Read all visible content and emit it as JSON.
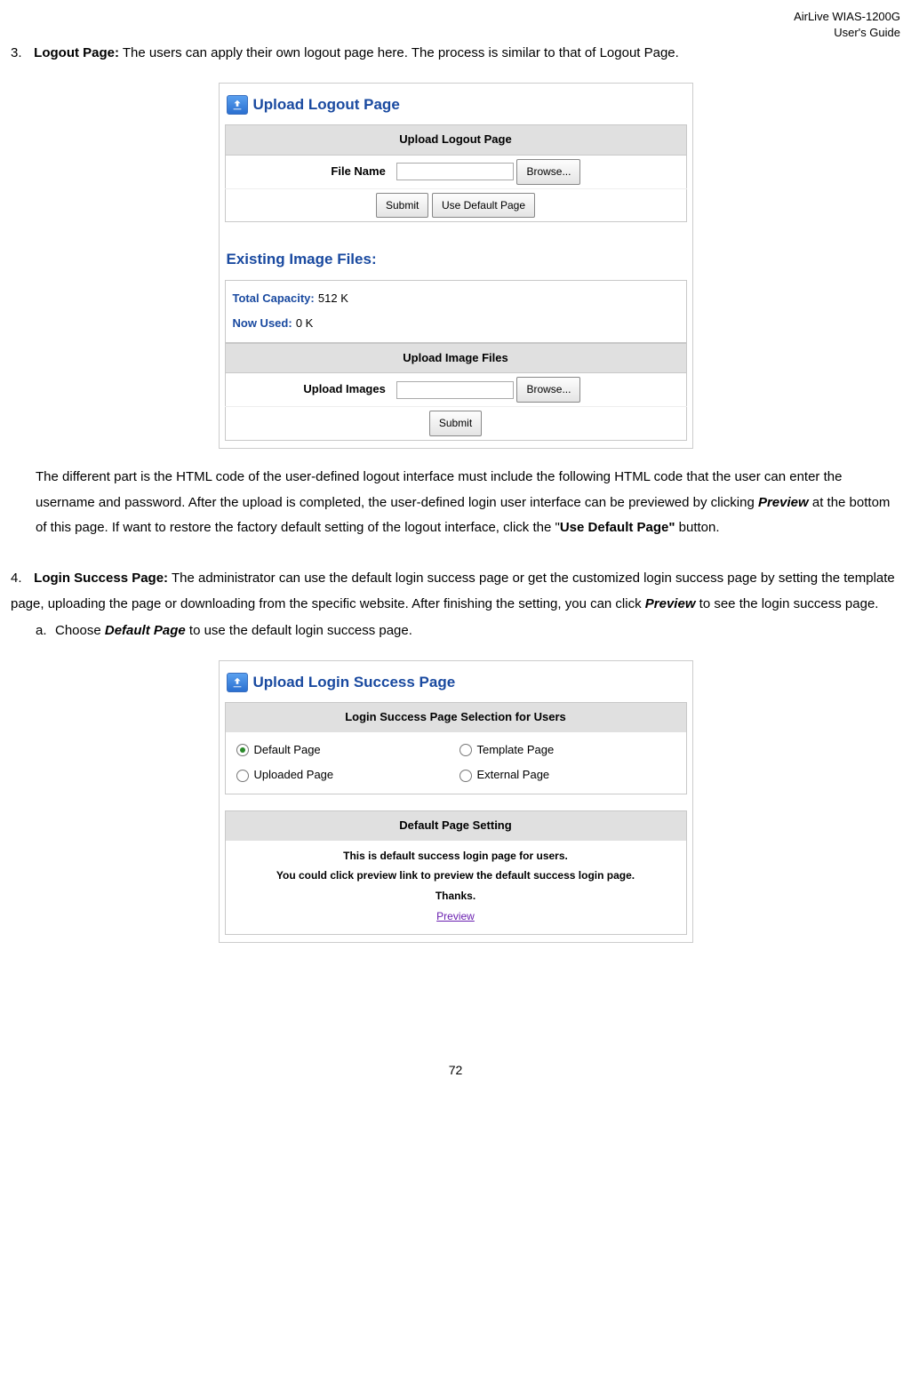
{
  "header": {
    "line1": "AirLive WIAS-1200G",
    "line2": "User's Guide"
  },
  "s3": {
    "num": "3.",
    "title": "Logout Page:",
    "tail": " The users can apply their own logout page here. The process is similar to that of Logout Page.",
    "panelTitle": "Upload Logout Page",
    "tbl1_hd": "Upload Logout Page",
    "fileNameLbl": "File Name",
    "browse": "Browse...",
    "submit": "Submit",
    "useDefault": "Use Default Page",
    "existingTitle": "Existing Image Files:",
    "totalCapLbl": "Total Capacity:",
    "totalCapVal": "512 K",
    "nowUsedLbl": "Now Used:",
    "nowUsedVal": "0 K",
    "tbl2_hd": "Upload Image Files",
    "uploadImagesLbl": "Upload Images",
    "paraPart1": "The different part is the HTML code of the user-defined logout interface must include the following HTML code that the user can enter the username and password. After the upload is completed, the user-defined login user interface can be previewed by clicking ",
    "previewWord": "Preview",
    "paraPart2": " at the bottom of this page. If want to restore the factory default setting of the logout interface, click the \"",
    "useDefaultBold": "Use Default Page\"",
    "paraPart3": " button."
  },
  "s4": {
    "num": "4.",
    "title": "Login Success Page:",
    "tail1": " The administrator can use the default login success page or get the customized login success page by setting the template page, uploading the page or downloading from the specific website. After finishing the setting, you can click ",
    "previewWord": "Preview",
    "tail2": " to see the login success page.",
    "sub_a_num": "a.",
    "sub_a_pre": "Choose ",
    "sub_a_bold": "Default Page",
    "sub_a_post": " to use the default login success page.",
    "panelTitle": "Upload Login Success Page",
    "selHd": "Login Success Page Selection for Users",
    "optDefault": "Default Page",
    "optTemplate": "Template Page",
    "optUploaded": "Uploaded Page",
    "optExternal": "External Page",
    "defHd": "Default Page Setting",
    "defLine1": "This is default success login page for users.",
    "defLine2": "You could click preview link to preview the default success login page.",
    "defLine3": "Thanks.",
    "previewLink": "Preview"
  },
  "pageNum": "72"
}
